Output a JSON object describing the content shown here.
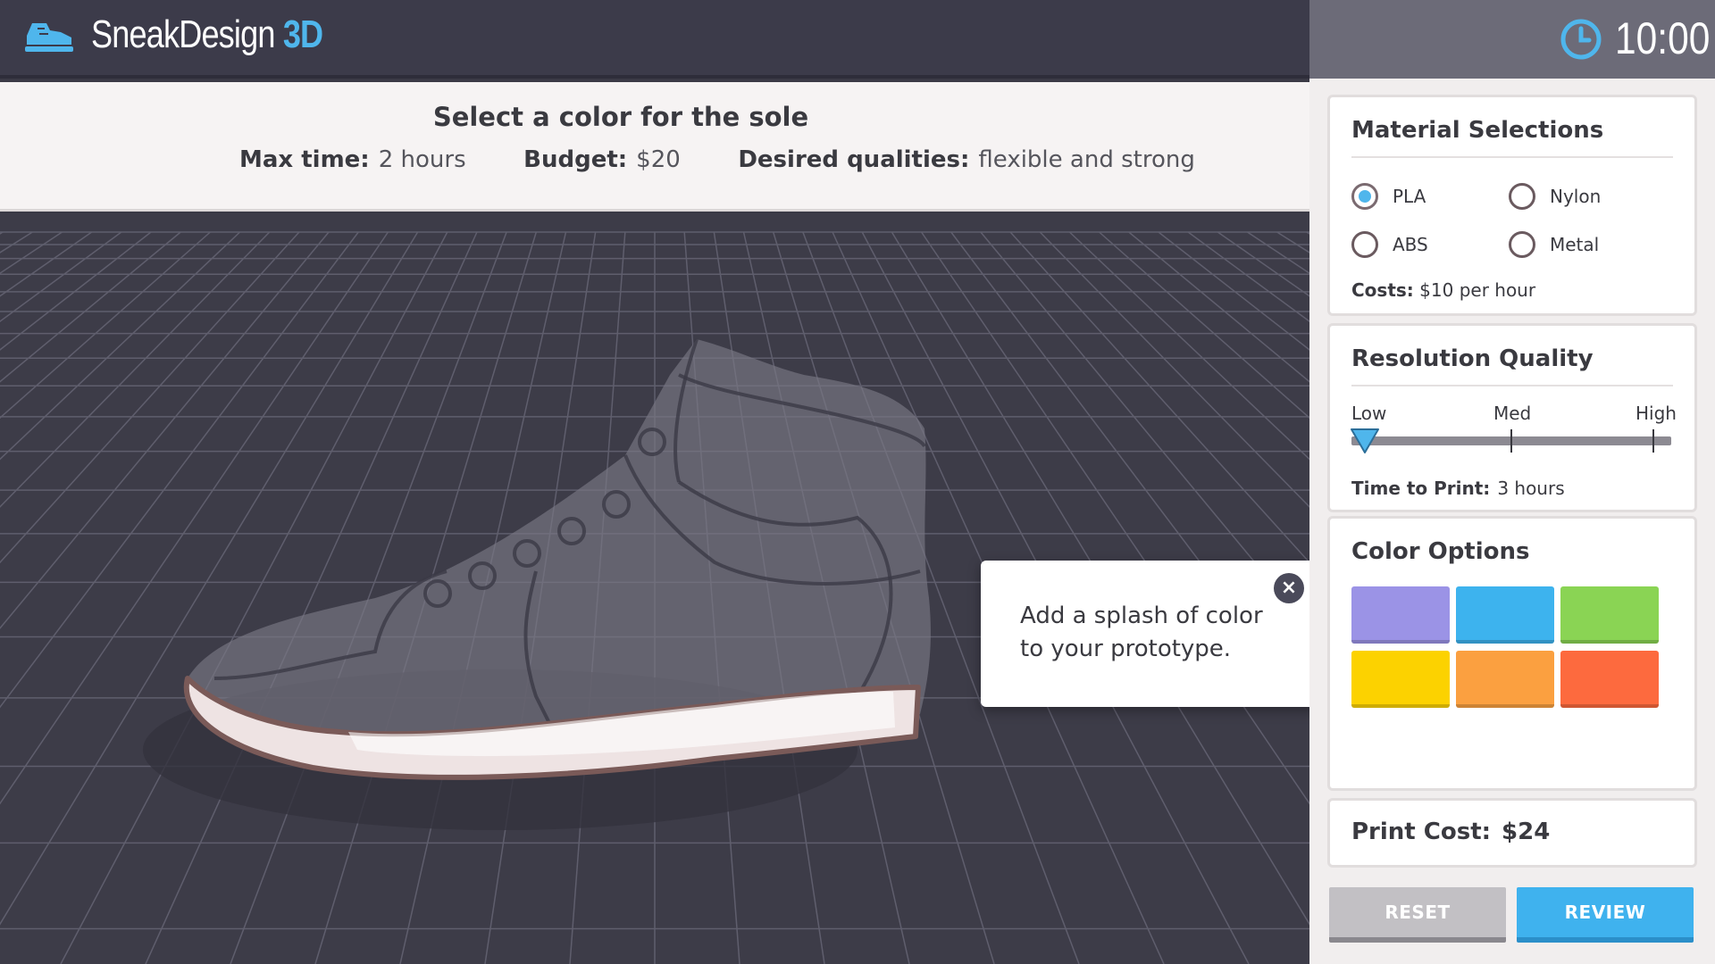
{
  "app": {
    "brand_name": "SneakDesign",
    "brand_suffix": "3D",
    "timer": "10:00"
  },
  "task": {
    "title": "Select a color for the sole",
    "max_time_label": "Max time:",
    "max_time_value": "2 hours",
    "budget_label": "Budget:",
    "budget_value": "$20",
    "qualities_label": "Desired qualities:",
    "qualities_value": "flexible and strong"
  },
  "tooltip": {
    "text": "Add a splash of color to your prototype.",
    "close_glyph": "×"
  },
  "material": {
    "title": "Material Selections",
    "options": [
      {
        "label": "PLA",
        "selected": true
      },
      {
        "label": "Nylon",
        "selected": false
      },
      {
        "label": "ABS",
        "selected": false
      },
      {
        "label": "Metal",
        "selected": false
      }
    ],
    "costs_label": "Costs:",
    "costs_value": "$10 per hour"
  },
  "resolution": {
    "title": "Resolution Quality",
    "levels": [
      "Low",
      "Med",
      "High"
    ],
    "selected_level": "Low",
    "time_label": "Time to Print:",
    "time_value": "3 hours"
  },
  "color_options": {
    "title": "Color Options",
    "swatches": [
      "#9b93e6",
      "#3db3ee",
      "#8ad454",
      "#fcd200",
      "#fba040",
      "#fd6a3e"
    ]
  },
  "print_cost": {
    "label": "Print Cost:",
    "value": "$24"
  },
  "buttons": {
    "reset": "RESET",
    "review": "REVIEW"
  },
  "colors": {
    "accent": "#4fb6ec",
    "header_bg": "#3c3b4a",
    "viewport_bg": "#3d3c48"
  },
  "icons": {
    "logo": "sneaker-icon",
    "timer": "clock-icon",
    "close": "close-icon"
  }
}
